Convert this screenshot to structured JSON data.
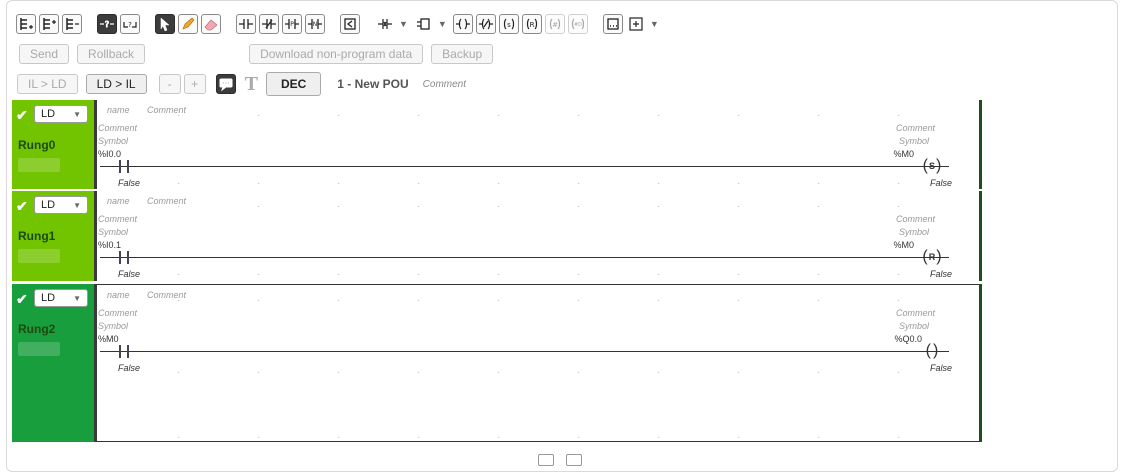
{
  "toolbar2": {
    "send": "Send",
    "rollback": "Rollback",
    "download": "Download non-program data",
    "backup": "Backup"
  },
  "toolbar3": {
    "il_to_ld": "IL > LD",
    "ld_to_il": "LD > IL",
    "minus": "-",
    "plus": "+",
    "text_glyph": "T",
    "dec": "DEC",
    "pou_title": "1 - New POU",
    "pou_comment": "Comment"
  },
  "rungs": [
    {
      "mode": "LD",
      "name": "Rung0",
      "hdr_name": "name",
      "hdr_comment": "Comment",
      "left": {
        "comment": "Comment",
        "symbol": "Symbol",
        "address": "%I0.0",
        "state": "False"
      },
      "right": {
        "comment": "Comment",
        "symbol": "Symbol",
        "address": "%M0",
        "state": "False",
        "coil": "S"
      }
    },
    {
      "mode": "LD",
      "name": "Rung1",
      "hdr_name": "name",
      "hdr_comment": "Comment",
      "left": {
        "comment": "Comment",
        "symbol": "Symbol",
        "address": "%I0.1",
        "state": "False"
      },
      "right": {
        "comment": "Comment",
        "symbol": "Symbol",
        "address": "%M0",
        "state": "False",
        "coil": "R"
      }
    },
    {
      "mode": "LD",
      "name": "Rung2",
      "hdr_name": "name",
      "hdr_comment": "Comment",
      "left": {
        "comment": "Comment",
        "symbol": "Symbol",
        "address": "%M0",
        "state": "False"
      },
      "right": {
        "comment": "Comment",
        "symbol": "Symbol",
        "address": "%Q0.0",
        "state": "False",
        "coil": ""
      }
    }
  ],
  "colors": {
    "rung_active": "#73c400",
    "rung_selected": "#189e3c"
  }
}
